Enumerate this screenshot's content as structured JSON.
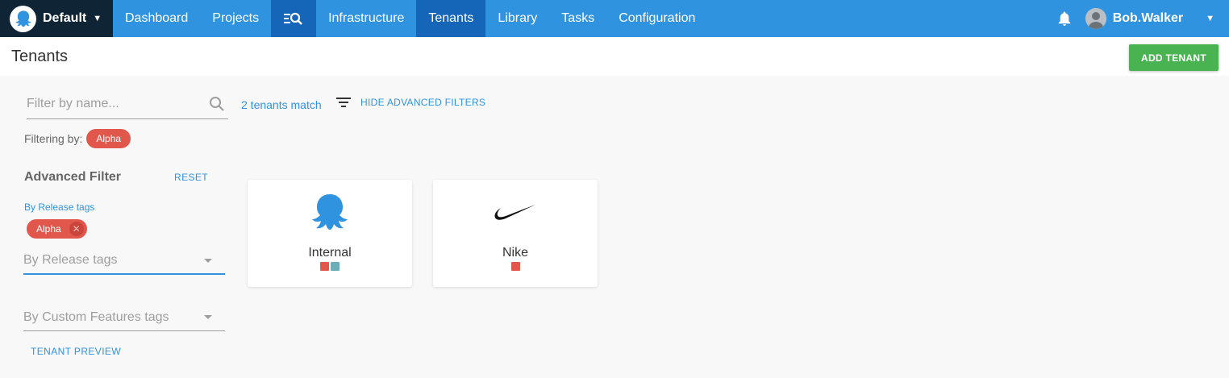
{
  "nav": {
    "space": "Default",
    "items": [
      "Dashboard",
      "Projects",
      "Infrastructure",
      "Tenants",
      "Library",
      "Tasks",
      "Configuration"
    ],
    "active": "Tenants",
    "user": "Bob.Walker"
  },
  "page": {
    "title": "Tenants",
    "add_button": "ADD TENANT"
  },
  "filters": {
    "search_placeholder": "Filter by name...",
    "filtering_by_label": "Filtering by:",
    "filtering_by_chip": "Alpha",
    "match_count": "2 tenants match",
    "hide_advanced": "HIDE ADVANCED FILTERS",
    "advanced_title": "Advanced Filter",
    "reset": "RESET",
    "release_tags_label": "By Release tags",
    "release_selected_chip": "Alpha",
    "release_select_placeholder": "By Release tags",
    "custom_select_placeholder": "By Custom Features tags",
    "tenant_preview": "TENANT PREVIEW"
  },
  "tenants": [
    {
      "name": "Internal",
      "logo": "octopus-logo",
      "tag_colors": [
        "#e2574c",
        "#6baeba"
      ]
    },
    {
      "name": "Nike",
      "logo": "nike-swoosh-logo",
      "tag_colors": [
        "#e2574c"
      ]
    }
  ],
  "colors": {
    "nav": "#2f93e0",
    "nav_active": "#1565b8",
    "space_switch": "#0f2535",
    "accent": "#2f93e0",
    "add_button": "#48b350",
    "tag_alpha": "#e2574c",
    "tag_teal": "#6baeba"
  }
}
